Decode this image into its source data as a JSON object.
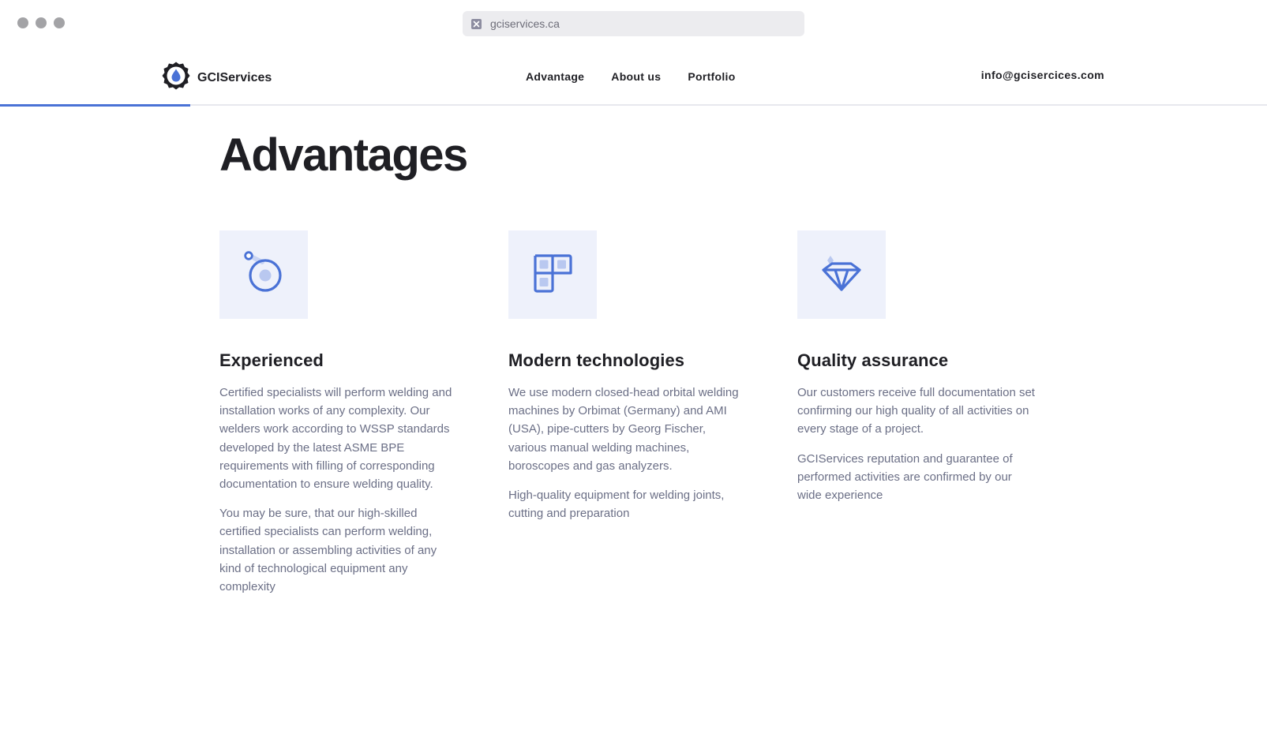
{
  "browser": {
    "url": "gciservices.ca"
  },
  "header": {
    "logo_text": "GCIServices",
    "nav": [
      {
        "label": "Advantage"
      },
      {
        "label": "About us"
      },
      {
        "label": "Portfolio"
      }
    ],
    "email": "info@gcisercices.com",
    "scroll_progress": 0.15
  },
  "main": {
    "title": "Advantages",
    "cards": [
      {
        "icon": "target-icon",
        "title": "Experienced",
        "paragraphs": [
          "Certified specialists will perform welding and installation works of any complexity. Our welders work according to WSSP standards developed by the latest ASME BPE requirements with filling of corresponding documentation to ensure welding quality.",
          "You may be sure, that our high-skilled certified specialists can perform welding, installation or assembling activities of any kind of technological equipment any complexity"
        ]
      },
      {
        "icon": "modules-icon",
        "title": "Modern technologies",
        "paragraphs": [
          "We use modern closed-head orbital welding machines by Orbimat (Germany) and AMI (USA), pipe-cutters by Georg Fischer, various manual welding machines, boroscopes and gas analyzers.",
          "High-quality equipment for welding joints, cutting and preparation"
        ]
      },
      {
        "icon": "diamond-icon",
        "title": "Quality assurance",
        "paragraphs": [
          "Our customers receive full documentation set confirming our high quality of all activities on every stage of a project.",
          "GCIServices reputation and guarantee of performed activities are confirmed by our wide experience"
        ]
      }
    ]
  },
  "colors": {
    "accent": "#4a72d6",
    "icon_bg": "#eef1fb",
    "text_muted": "#6b6f86",
    "heading": "#1f1f24"
  }
}
